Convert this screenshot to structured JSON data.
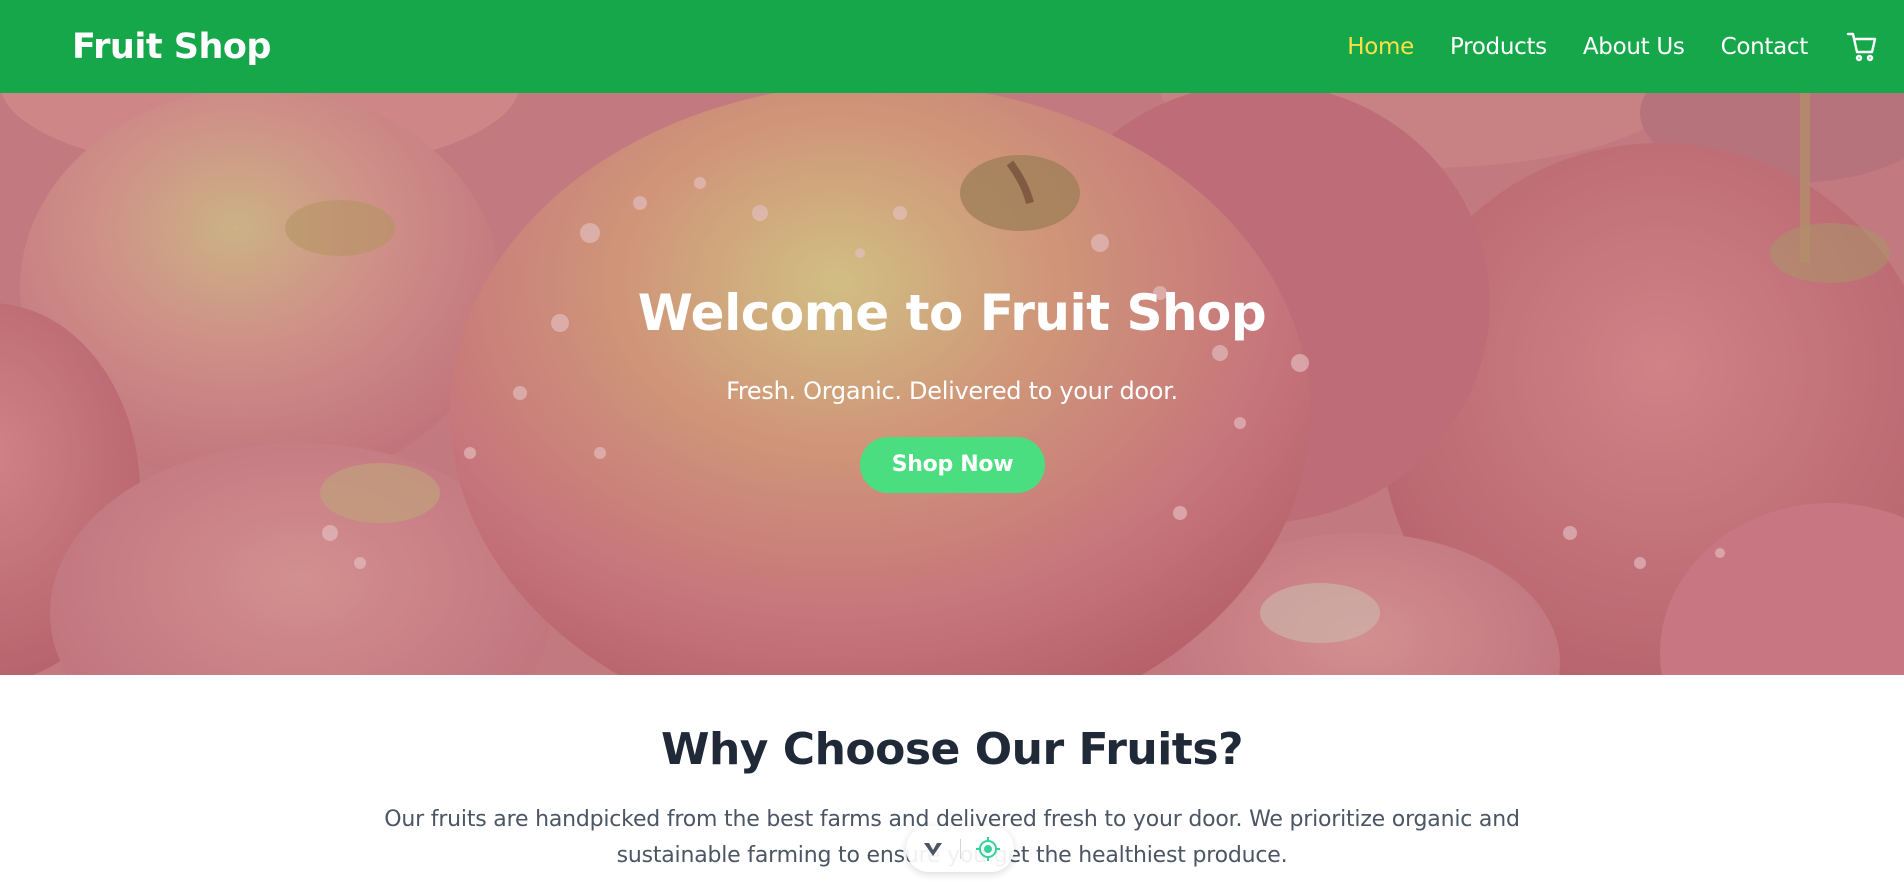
{
  "navbar": {
    "brand": "Fruit Shop",
    "links": [
      {
        "label": "Home",
        "active": true
      },
      {
        "label": "Products",
        "active": false
      },
      {
        "label": "About Us",
        "active": false
      },
      {
        "label": "Contact",
        "active": false
      }
    ],
    "cart_icon": "cart-icon",
    "background": "#17a74b",
    "active_color": "#fde047"
  },
  "hero": {
    "title": "Welcome to Fruit Shop",
    "subtitle": "Fresh. Organic. Delivered to your door.",
    "cta_label": "Shop Now",
    "cta_color": "#4ade80",
    "background_image": "apples-photo"
  },
  "section": {
    "title": "Why Choose Our Fruits?",
    "body": "Our fruits are handpicked from the best farms and delivered fresh to your door. We prioritize organic and sustainable farming to ensure you get the healthiest produce."
  },
  "toolbar": {
    "icons": [
      "chevron-down-icon",
      "target-icon"
    ]
  }
}
